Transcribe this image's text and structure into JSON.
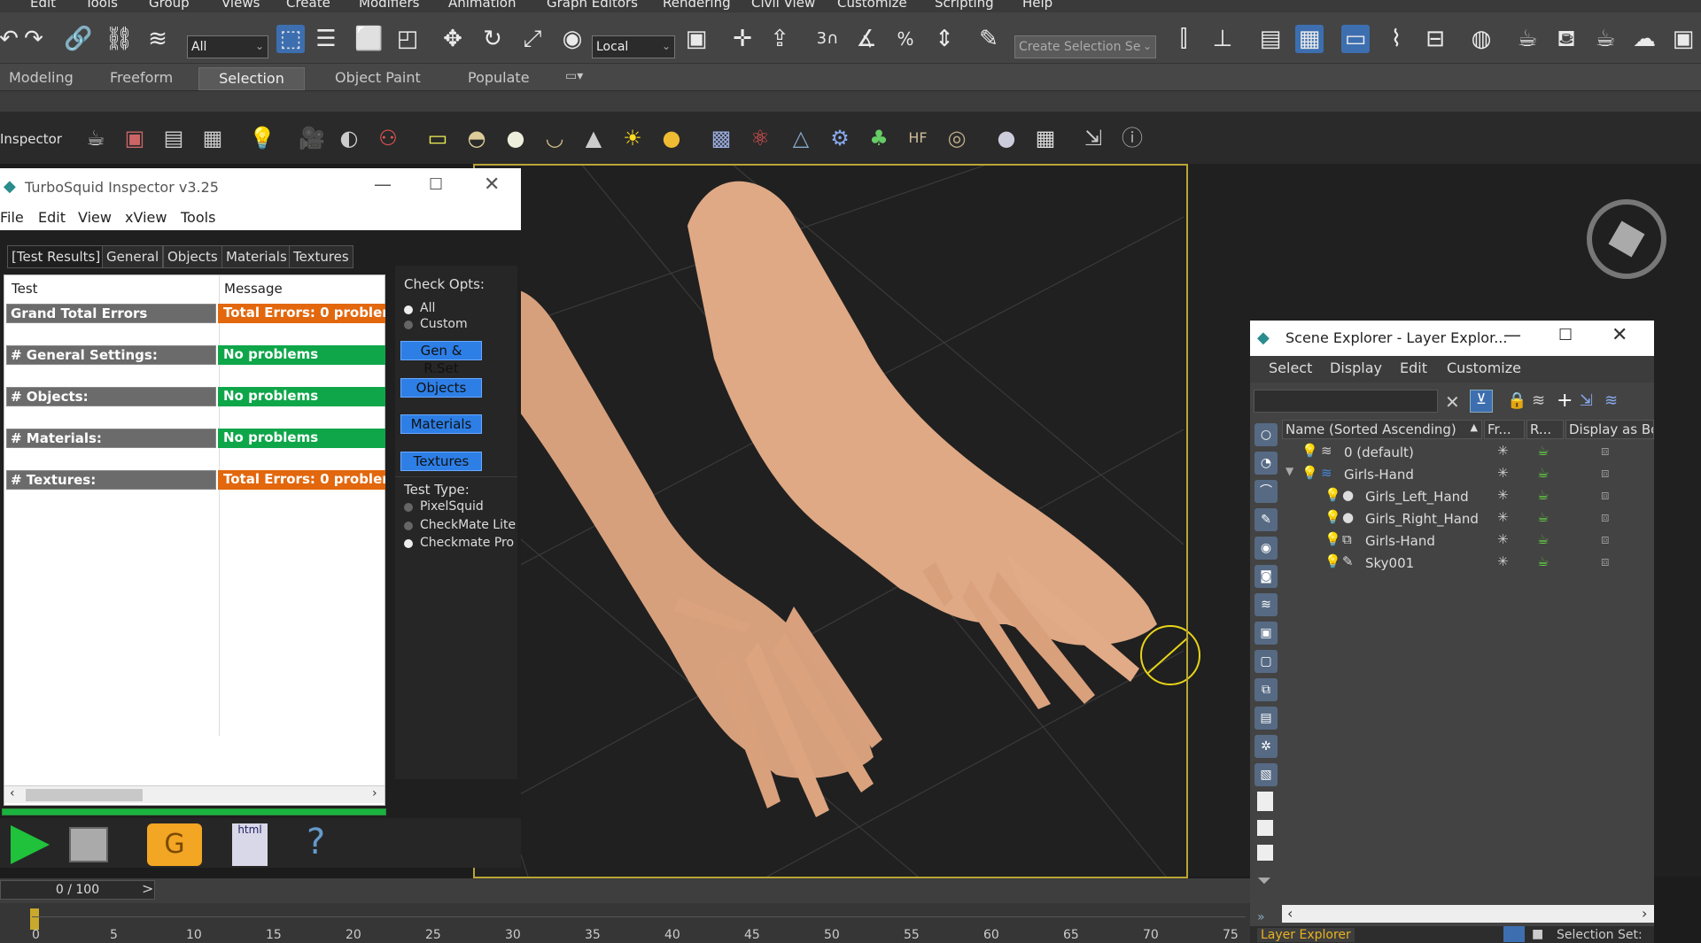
{
  "menubar": {
    "items": [
      "Edit",
      "Tools",
      "Group",
      "Views",
      "Create",
      "Modifiers",
      "Animation",
      "Graph Editors",
      "Rendering",
      "Civil View",
      "Customize",
      "Scripting",
      "Help"
    ]
  },
  "toolbar": {
    "filter_value": "All",
    "coord_value": "Local",
    "named_selection_placeholder": "Create Selection Se",
    "icons": [
      "redo-icon",
      "link-icon",
      "unlink-icon",
      "bind-spacewarp-icon",
      "select-object-icon",
      "select-by-name-icon",
      "rect-region-icon",
      "window-crossing-icon",
      "move-icon",
      "rotate-icon",
      "scale-icon",
      "placement-icon",
      "pivot-icon",
      "manipulate-icon",
      "keyboard-shortcut-icon",
      "snap-icon",
      "angle-snap-icon",
      "percent-snap-icon",
      "spinner-snap-icon",
      "edit-named-sets-icon",
      "mirror-icon",
      "align-icon",
      "layer-explorer-icon",
      "toggle-ribbon-icon",
      "curve-editor-icon",
      "schematic-view-icon",
      "material-editor-icon",
      "render-setup-icon",
      "rendered-frame-icon",
      "render-icon",
      "render-iterative-icon",
      "render-cloud-icon"
    ],
    "snap_label": "3"
  },
  "ribbon": {
    "tabs": [
      "Modeling",
      "Freeform",
      "Selection",
      "Object Paint",
      "Populate"
    ],
    "active": "Selection"
  },
  "cmdbar": {
    "label": "Inspector",
    "icons": [
      "teapot-icon",
      "render-frame-icon",
      "list-icon",
      "grid-list-icon",
      "light-icon",
      "camera-icon",
      "sphere-half-icon",
      "people-icon",
      "box-icon",
      "dome-icon",
      "sphere-icon",
      "bowl-icon",
      "cone-icon",
      "sun-icon",
      "ball-icon",
      "grid-icon",
      "molecule-icon",
      "pyramid-icon",
      "gear-icon",
      "plant-icon",
      "hair-icon",
      "texture-icon",
      "sphere-gray-icon",
      "checker-icon",
      "export-icon",
      "help-icon"
    ]
  },
  "inspector": {
    "title": "TurboSquid Inspector v3.25",
    "menu": [
      "File",
      "Edit",
      "View",
      "xView",
      "Tools"
    ],
    "tabs": [
      "[Test Results]",
      "General",
      "Objects",
      "Materials",
      "Textures"
    ],
    "columns": [
      "Test",
      "Message"
    ],
    "rows": [
      {
        "test": "Grand Total Errors",
        "message": "Total Errors: 0 problem(",
        "status": "orange"
      },
      {
        "test": "# General Settings:",
        "message": "No problems",
        "status": "green"
      },
      {
        "test": "# Objects:",
        "message": "No problems",
        "status": "green"
      },
      {
        "test": "# Materials:",
        "message": "No problems",
        "status": "green"
      },
      {
        "test": "# Textures:",
        "message": "Total Errors: 0 problem(",
        "status": "orange"
      }
    ],
    "check_opts_label": "Check Opts:",
    "check_opts": [
      "All",
      "Custom"
    ],
    "check_opts_selected": "All",
    "buttons": [
      "Gen & R.Set",
      "Objects",
      "Materials",
      "Textures"
    ],
    "test_type_label": "Test Type:",
    "test_types": [
      "PixelSquid",
      "CheckMate Lite",
      "Checkmate Pro"
    ],
    "test_type_selected": "Checkmate Pro",
    "progress": 1.0,
    "bottom_icons": [
      "play-icon",
      "save-icon",
      "folder-icon",
      "html-icon",
      "help-icon"
    ],
    "html_label": "html"
  },
  "scene_explorer": {
    "title": "Scene Explorer - Layer Explor...",
    "menu": [
      "Select",
      "Display",
      "Edit",
      "Customize"
    ],
    "columns": [
      "Name (Sorted Ascending)",
      "Fr...",
      "R...",
      "Display as Box"
    ],
    "rows": [
      {
        "name": "0 (default)",
        "level": 0,
        "type": "layer"
      },
      {
        "name": "Girls-Hand",
        "level": 0,
        "type": "layer-expanded"
      },
      {
        "name": "Girls_Left_Hand",
        "level": 1,
        "type": "mesh"
      },
      {
        "name": "Girls_Right_Hand",
        "level": 1,
        "type": "mesh"
      },
      {
        "name": "Girls-Hand",
        "level": 1,
        "type": "group"
      },
      {
        "name": "Sky001",
        "level": 1,
        "type": "light"
      }
    ],
    "bottom_tab": "Layer Explorer",
    "bottom_right": "Selection Set:"
  },
  "timeline": {
    "frame": "0 / 100",
    "ticks": [
      "0",
      "5",
      "10",
      "15",
      "20",
      "25",
      "30",
      "35",
      "40",
      "45",
      "50",
      "55",
      "60",
      "65",
      "70",
      "75"
    ]
  },
  "colors": {
    "accent_blue": "#2d7fe6",
    "ok_green": "#0fa64a",
    "error_orange": "#e2670d",
    "viewport_frame": "#b8a534"
  }
}
